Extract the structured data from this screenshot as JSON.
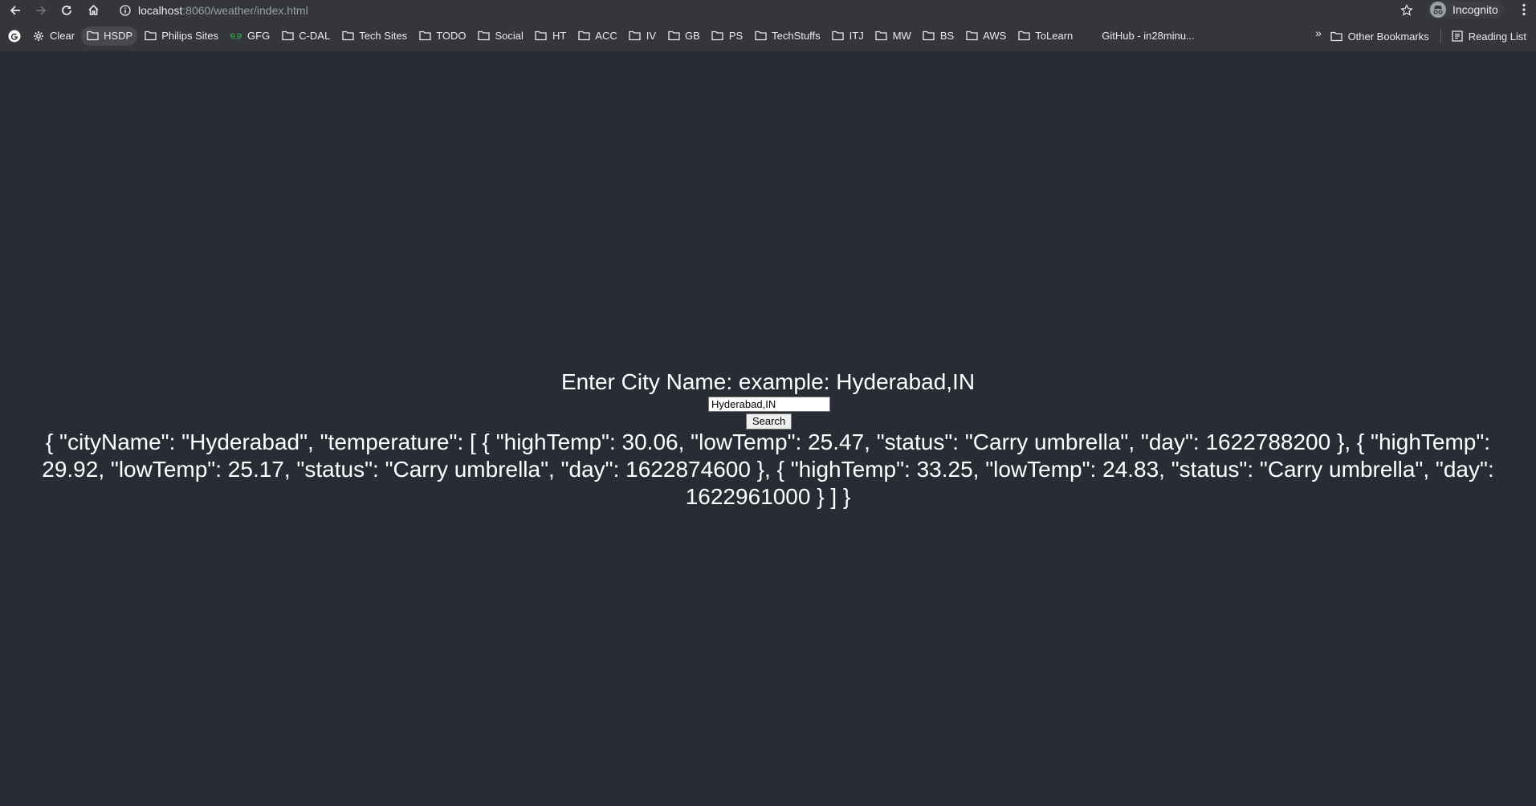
{
  "browser": {
    "url_host": "localhost",
    "url_path": ":8060/weather/index.html",
    "profile_label": "Incognito"
  },
  "bookmarks": {
    "items": [
      {
        "label": "Clear",
        "icon": "gear-icon"
      },
      {
        "label": "HSDP",
        "icon": "folder-icon",
        "active": true
      },
      {
        "label": "Philips Sites",
        "icon": "folder-icon"
      },
      {
        "label": "GFG",
        "icon": "gfg-icon"
      },
      {
        "label": "C-DAL",
        "icon": "folder-icon"
      },
      {
        "label": "Tech Sites",
        "icon": "folder-icon"
      },
      {
        "label": "TODO",
        "icon": "folder-icon"
      },
      {
        "label": "Social",
        "icon": "folder-icon"
      },
      {
        "label": "HT",
        "icon": "folder-icon"
      },
      {
        "label": "ACC",
        "icon": "folder-icon"
      },
      {
        "label": "IV",
        "icon": "folder-icon"
      },
      {
        "label": "GB",
        "icon": "folder-icon"
      },
      {
        "label": "PS",
        "icon": "folder-icon"
      },
      {
        "label": "TechStuffs",
        "icon": "folder-icon"
      },
      {
        "label": "ITJ",
        "icon": "folder-icon"
      },
      {
        "label": "MW",
        "icon": "folder-icon"
      },
      {
        "label": "BS",
        "icon": "folder-icon"
      },
      {
        "label": "AWS",
        "icon": "folder-icon"
      },
      {
        "label": "ToLearn",
        "icon": "folder-icon"
      },
      {
        "label": "GitHub - in28minu...",
        "icon": "github-icon"
      }
    ],
    "overflow_label": "»",
    "other_bookmarks_label": "Other Bookmarks",
    "reading_list_label": "Reading List"
  },
  "page": {
    "heading": "Enter City Name: example: Hyderabad,IN",
    "input_value": "Hyderabad,IN",
    "search_label": "Search",
    "result_text": "{ \"cityName\": \"Hyderabad\", \"temperature\": [ { \"highTemp\": 30.06, \"lowTemp\": 25.47, \"status\": \"Carry umbrella\", \"day\": 1622788200 }, { \"highTemp\": 29.92, \"lowTemp\": 25.17, \"status\": \"Carry umbrella\", \"day\": 1622874600 }, { \"highTemp\": 33.25, \"lowTemp\": 24.83, \"status\": \"Carry umbrella\", \"day\": 1622961000 } ] }"
  },
  "colors": {
    "page_background": "#282c34",
    "chrome_background": "#35363a",
    "text": "#ffffff"
  }
}
